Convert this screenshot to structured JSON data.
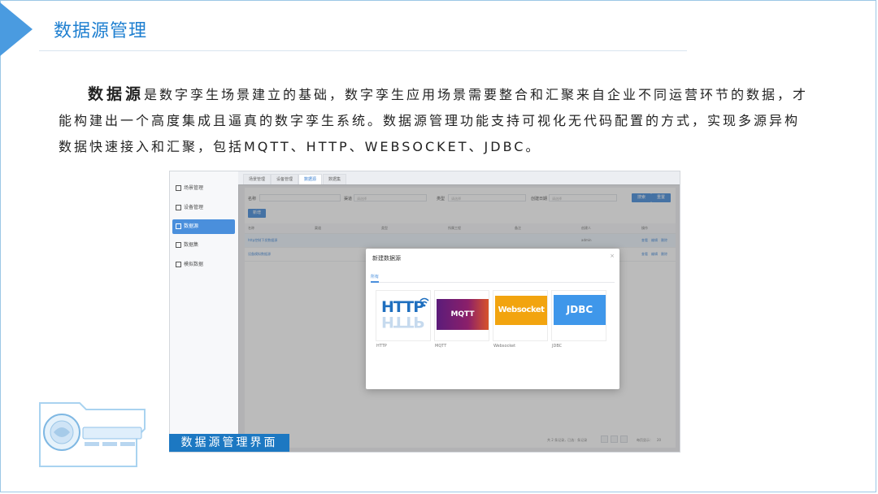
{
  "slide": {
    "title": "数据源管理",
    "para_bold": "数据源",
    "para_rest": "是数字孪生场景建立的基础，数字孪生应用场景需要整合和汇聚来自企业不同运营环节的数据，才能构建出一个高度集成且逼真的数字孪生系统。数据源管理功能支持可视化无代码配置的方式，实现多源异构数据快速接入和汇聚，包括MQTT、HTTP、WEBSOCKET、JDBC。",
    "caption": "数据源管理界面",
    "accent_color": "#1e7fd0",
    "caption_bg": "#1c78c2"
  },
  "app": {
    "sidebar": [
      {
        "label": "场景管理",
        "icon": "scene-icon"
      },
      {
        "label": "设备管理",
        "icon": "device-icon"
      },
      {
        "label": "数据源",
        "icon": "datasource-icon"
      },
      {
        "label": "数据集",
        "icon": "dataset-icon"
      },
      {
        "label": "模拟数据",
        "icon": "mock-data-icon"
      }
    ],
    "tabs": [
      "场景管理",
      "设备管理",
      "数据源",
      "数据集"
    ],
    "filters": {
      "name_label": "名称",
      "channel_label": "渠道",
      "channel_placeholder": "请选择",
      "type_label": "类型",
      "type_placeholder": "请选择",
      "date_label": "创建日期",
      "date_placeholder": "请选择",
      "search_btn": "搜索",
      "reset_btn": "重置"
    },
    "add_btn": "新增",
    "columns": [
      "名称",
      "渠道",
      "类型",
      "所属工程",
      "备注",
      "创建人",
      "操作"
    ],
    "rows": [
      {
        "name": "http控制下发数据源",
        "creator": "admin",
        "actions": [
          "查看",
          "编辑",
          "删除"
        ]
      },
      {
        "name": "设备模拟数据源",
        "creator": "admin",
        "actions": [
          "查看",
          "编辑",
          "删除"
        ]
      }
    ],
    "pager": {
      "summary": "共 2 条记录，已选：条记录",
      "size_label": "每页显示：",
      "size_value": "20"
    },
    "modal": {
      "title": "新建数据源",
      "tab": "所有",
      "options": [
        {
          "logo": "HTTP",
          "caption": "HTTP"
        },
        {
          "logo": "MQTT",
          "caption": "MQTT"
        },
        {
          "logo": "Websocket",
          "caption": "Websocket"
        },
        {
          "logo": "JDBC",
          "caption": "JDBC"
        }
      ]
    }
  }
}
